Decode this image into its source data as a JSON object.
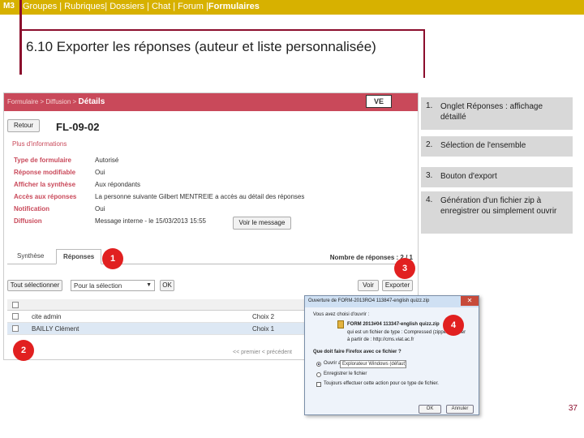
{
  "header": {
    "logo": "M3",
    "nav_items": "Groupes | Rubriques| Dossiers | Chat | Forum |",
    "nav_active": "Formulaires",
    "title": "6.10 Exporter les réponses (auteur et liste personnalisée)"
  },
  "screenshot": {
    "breadcrumb": "Formulaire > Diffusion >",
    "breadcrumb_current": "Détails",
    "brand_box": "VE",
    "back_label": "Retour",
    "form_code": "FL-09-02",
    "more_info": "Plus d'informations",
    "properties": [
      {
        "key": "Type de formulaire",
        "value": "Autorisé"
      },
      {
        "key": "Réponse modifiable",
        "value": "Oui"
      },
      {
        "key": "Afficher la synthèse",
        "value": "Aux répondants"
      },
      {
        "key": "Accès aux réponses",
        "value": "La personne suivante Gilbert MENTREIE a accès au détail des réponses"
      },
      {
        "key": "Notification",
        "value": "Oui"
      },
      {
        "key": "Diffusion",
        "value": "Message interne - le 15/03/2013 15:55"
      }
    ],
    "view_message_label": "Voir le message",
    "tabs": [
      {
        "label": "Synthèse"
      },
      {
        "label": "Réponses"
      }
    ],
    "responses_count": "Nombre de réponses : 2 / 1",
    "select_all_label": "Tout sélectionner",
    "selection_value": "Pour la sélection",
    "ok_label": "OK",
    "view_label": "Voir",
    "export_label": "Exporter",
    "rows": [
      {
        "name": "cite admin",
        "choice": "Choix 2"
      },
      {
        "name": "BAILLY Clément",
        "choice": "Choix 1"
      }
    ],
    "pager": "<< premier   < précédent"
  },
  "dialog": {
    "title": "Ouverture de FORM-2013RO4 113847-english quizz.zip",
    "intro": "Vous avez choisi d'ouvrir :",
    "filename": "FORM 2013#04 113347-english quizz.zip",
    "file_type": "qui est un fichier de type : Compressed (zipped) Folder",
    "file_source": "à partir de : http://cms.viat.ac.fr",
    "question": "Que doit faire Firefox avec ce fichier ?",
    "option_open": "Ouvrir avec",
    "open_with": "Explorateur Windows (défaut)",
    "option_save": "Enregistrer le fichier",
    "option_remember": "Toujours effectuer cette action pour ce type de fichier.",
    "ok_label": "OK",
    "cancel_label": "Annuler"
  },
  "callouts": [
    {
      "num": "1.",
      "text": "Onglet Réponses : affichage détaillé"
    },
    {
      "num": "2.",
      "text": "Sélection de l'ensemble"
    },
    {
      "num": "3.",
      "text": "Bouton d'export"
    },
    {
      "num": "4.",
      "text": "Génération d'un fichier zip à enregistrer ou simplement ouvrir"
    }
  ],
  "markers": [
    "1",
    "2",
    "3",
    "4"
  ],
  "page_number": "37",
  "colors": {
    "header_gold": "#d7b100",
    "accent_maroon": "#8b0d2c",
    "app_red": "#c9495a",
    "marker_red": "#e12020",
    "callout_gray": "#d8d8d8"
  }
}
